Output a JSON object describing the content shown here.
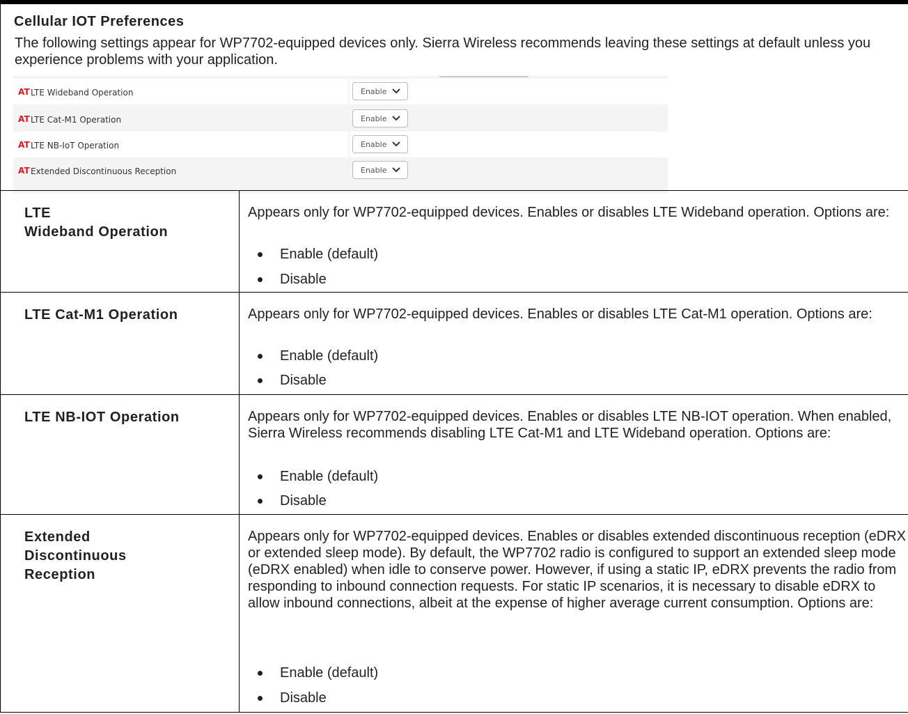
{
  "header": {
    "title": "Cellular IOT Preferences",
    "intro": "The following settings appear for WP7702-equipped devices only. Sierra Wireless recommends leaving these settings at default unless you experience problems with your application."
  },
  "screenshot": {
    "badge": "AT",
    "rows": [
      {
        "label": "LTE Wideband Operation",
        "value": "Enable"
      },
      {
        "label": "LTE Cat-M1 Operation",
        "value": "Enable"
      },
      {
        "label": "LTE NB-IoT Operation",
        "value": "Enable"
      },
      {
        "label": "Extended Discontinuous Reception",
        "value": "Enable"
      }
    ]
  },
  "definitions": [
    {
      "term": "LTE Wideband Operation",
      "description": "Appears only for WP7702-equipped devices. Enables or disables LTE Wideband operation. Options are:",
      "options": [
        "Enable (default)",
        "Disable"
      ]
    },
    {
      "term": "LTE Cat-M1 Operation",
      "description": "Appears only for WP7702-equipped devices. Enables or disables LTE Cat-M1 operation. Options are:",
      "options": [
        "Enable (default)",
        "Disable"
      ]
    },
    {
      "term": "LTE NB-IOT Operation",
      "description": "Appears only for WP7702-equipped devices. Enables or disables LTE NB-IOT operation. When enabled, Sierra Wireless recommends disabling LTE Cat-M1 and LTE Wideband operation. Options are:",
      "options": [
        "Enable (default)",
        "Disable"
      ]
    },
    {
      "term": "Extended Discontinuous Reception",
      "description": "Appears only for WP7702-equipped devices. Enables or disables extended discontinuous reception (eDRX or extended sleep mode). By default, the WP7702 radio is configured to support an extended sleep mode (eDRX enabled) when idle to conserve power. However, if using a static IP, eDRX prevents the radio from responding to inbound connection requests. For static IP scenarios, it is necessary to disable eDRX to allow inbound connections, albeit at the expense of higher average current consumption. Options are:",
      "options": [
        "Enable (default)",
        "Disable"
      ]
    }
  ],
  "colors": {
    "badge": "#e8121a",
    "text": "#231f20",
    "rule": "#000000"
  }
}
